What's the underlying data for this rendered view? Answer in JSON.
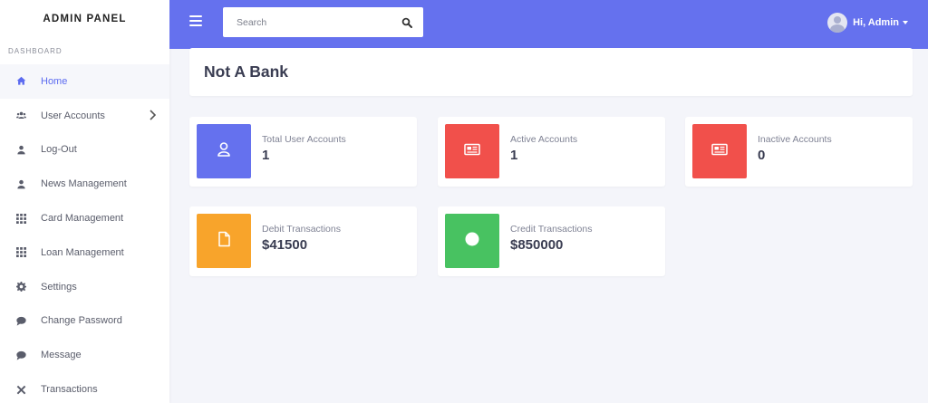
{
  "brand": "ADMIN PANEL",
  "section_label": "DASHBOARD",
  "sidebar": {
    "items": [
      {
        "label": "Home",
        "icon": "home-icon"
      },
      {
        "label": "User Accounts",
        "icon": "users-icon"
      },
      {
        "label": "Log-Out",
        "icon": "user-icon"
      },
      {
        "label": "News Management",
        "icon": "user-icon"
      },
      {
        "label": "Card Management",
        "icon": "grid-icon"
      },
      {
        "label": "Loan Management",
        "icon": "grid-icon"
      },
      {
        "label": "Settings",
        "icon": "gear-icon"
      },
      {
        "label": "Change Password",
        "icon": "comment-icon"
      },
      {
        "label": "Message",
        "icon": "comment-icon"
      },
      {
        "label": "Transactions",
        "icon": "tools-icon"
      }
    ]
  },
  "topbar": {
    "search_placeholder": "Search",
    "user_greeting": "Hi, Admin"
  },
  "page_title": "Not A Bank",
  "cards": [
    {
      "label": "Total User Accounts",
      "value": "1",
      "color": "#6571ee",
      "icon": "user-outline-icon"
    },
    {
      "label": "Active Accounts",
      "value": "1",
      "color": "#f1504b",
      "icon": "newspaper-icon"
    },
    {
      "label": "Inactive Accounts",
      "value": "0",
      "color": "#f1504b",
      "icon": "newspaper-icon"
    },
    {
      "label": "Debit Transactions",
      "value": "$41500",
      "color": "#f8a42b",
      "icon": "file-icon"
    },
    {
      "label": "Credit Transactions",
      "value": "$850000",
      "color": "#48c261",
      "icon": "circle-icon"
    }
  ],
  "colors": {
    "accent": "#6571ee",
    "danger": "#f1504b",
    "warning": "#f8a42b",
    "success": "#48c261"
  }
}
